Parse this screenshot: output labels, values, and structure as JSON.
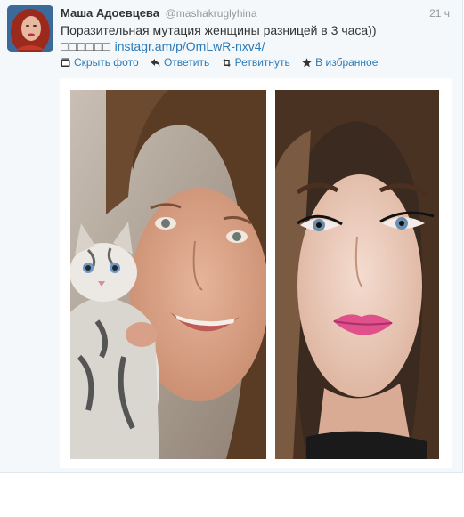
{
  "tweet": {
    "name": "Маша Адоевцева",
    "handle": "@mashakruglyhina",
    "time": "21 ч",
    "text_line1": "Поразительная мутация женщины разницей в 3 часа))",
    "text_boxes": "□□□□□□",
    "link": "instagr.am/p/OmLwR-nxv4/"
  },
  "actions": {
    "hide_photo": "Скрыть фото",
    "reply": "Ответить",
    "retweet": "Ретвитнуть",
    "favorite": "В избранное"
  },
  "colors": {
    "link": "#2a7ab8",
    "name": "#333333",
    "meta": "#999999",
    "background": "#f5f8fa"
  },
  "icons": [
    "photo-icon",
    "reply-arrow-icon",
    "retweet-icon",
    "star-icon"
  ]
}
